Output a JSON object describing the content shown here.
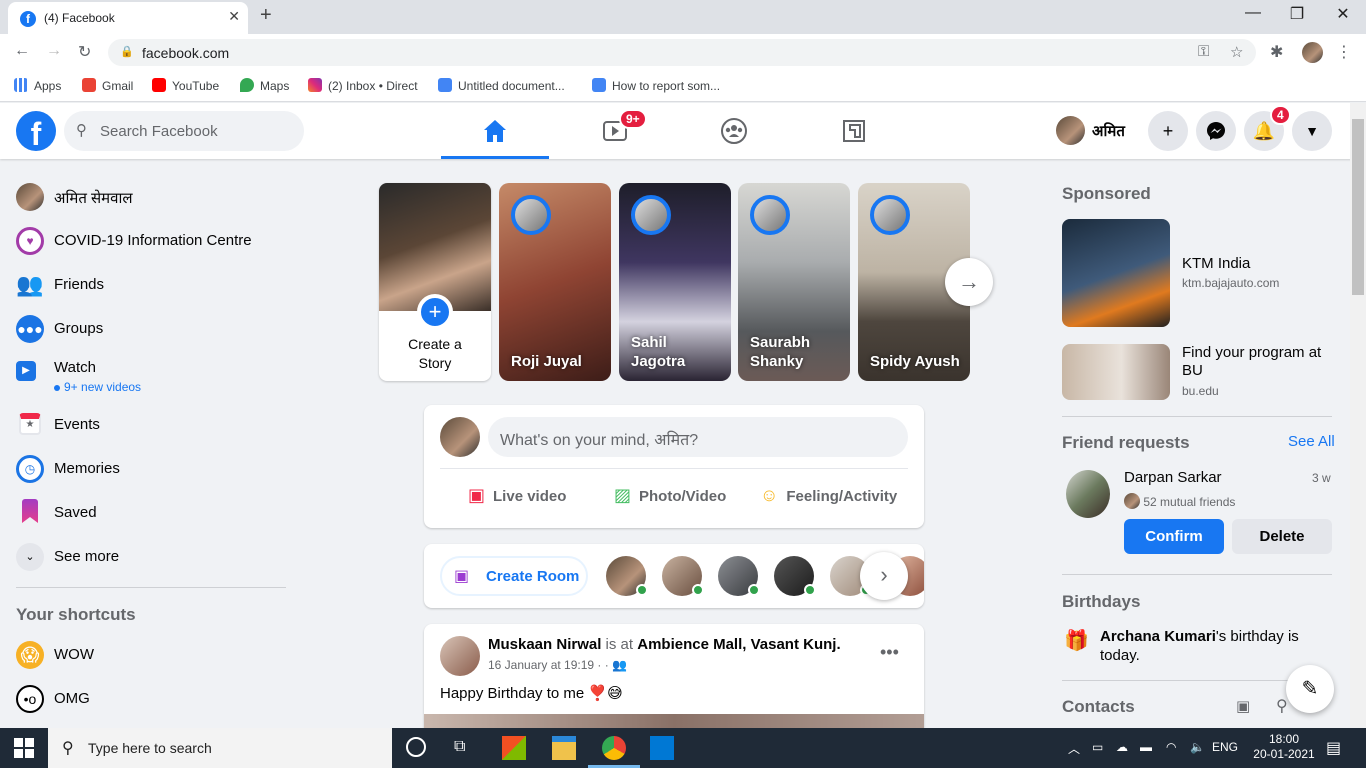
{
  "browser": {
    "tab_title": "(4) Facebook",
    "url": "facebook.com",
    "bookmarks": [
      "Apps",
      "Gmail",
      "YouTube",
      "Maps",
      "(2) Inbox • Direct",
      "Untitled document...",
      "How to report som..."
    ]
  },
  "header": {
    "search_placeholder": "Search Facebook",
    "watch_badge": "9+",
    "notifications_badge": "4",
    "profile_name": "अमित"
  },
  "left_sidebar": {
    "items": [
      {
        "label": "अमित सेमवाल",
        "icon": "avatar"
      },
      {
        "label": "COVID-19 Information Centre",
        "icon": "covid-icon"
      },
      {
        "label": "Friends",
        "icon": "friends-icon"
      },
      {
        "label": "Groups",
        "icon": "groups-icon"
      },
      {
        "label": "Watch",
        "icon": "watch-icon",
        "sub": "9+ new videos"
      },
      {
        "label": "Events",
        "icon": "events-icon"
      },
      {
        "label": "Memories",
        "icon": "memories-icon"
      },
      {
        "label": "Saved",
        "icon": "saved-icon"
      },
      {
        "label": "See more",
        "icon": "chevron-down-icon"
      }
    ],
    "shortcuts_title": "Your shortcuts",
    "shortcuts": [
      {
        "label": "WOW",
        "icon": "wow-icon"
      },
      {
        "label": "OMG",
        "icon": "omg-icon"
      }
    ]
  },
  "stories": {
    "create_label_line1": "Create a",
    "create_label_line2": "Story",
    "items": [
      {
        "name": "Roji Juyal",
        "color": "#9b4b3a"
      },
      {
        "name": "Sahil Jagotra",
        "color": "#4a3f66"
      },
      {
        "name": "Saurabh Shanky",
        "color": "#8c8f94"
      },
      {
        "name": "Spidy Ayush",
        "color": "#a09a8f"
      }
    ]
  },
  "composer": {
    "placeholder": "What's on your mind, अमित?",
    "actions": [
      "Live video",
      "Photo/Video",
      "Feeling/Activity"
    ]
  },
  "rooms": {
    "create_label": "Create Room"
  },
  "post": {
    "author": "Muskaan Nirwal",
    "is_at": "is at",
    "location": "Ambience Mall, Vasant Kunj.",
    "timestamp": "16 January at 19:19 · ·",
    "text": "Happy Birthday to me",
    "emojis": "❣️😅"
  },
  "right_sidebar": {
    "sponsored_title": "Sponsored",
    "ads": [
      {
        "title": "KTM India",
        "domain": "ktm.bajajauto.com"
      },
      {
        "title": "Find your program at BU",
        "domain": "bu.edu"
      }
    ],
    "friend_requests_title": "Friend requests",
    "see_all": "See All",
    "request": {
      "name": "Darpan Sarkar",
      "time": "3 w",
      "mutual": "52 mutual friends",
      "confirm": "Confirm",
      "delete": "Delete"
    },
    "birthdays_title": "Birthdays",
    "birthday_name": "Archana Kumari",
    "birthday_text": "'s birthday is today.",
    "contacts_title": "Contacts"
  },
  "taskbar": {
    "search_placeholder": "Type here to search",
    "lang": "ENG",
    "time": "18:00",
    "date": "20-01-2021"
  },
  "colors": {
    "brand": "#1877f2",
    "badge": "#e41e3f"
  }
}
